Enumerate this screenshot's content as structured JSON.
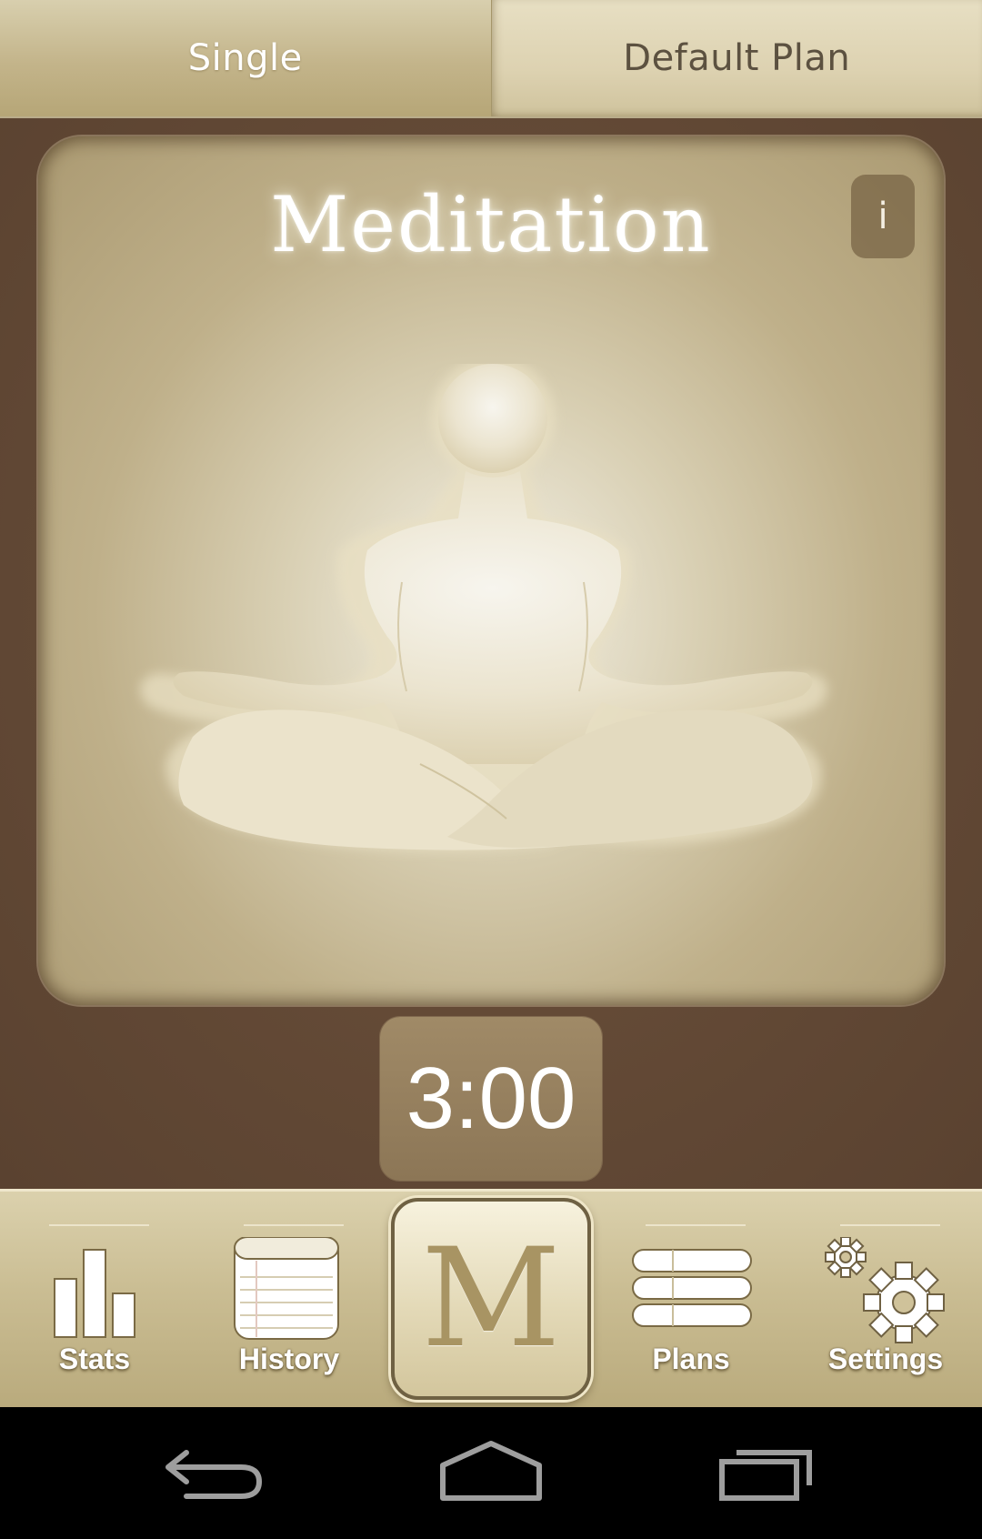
{
  "top_tabs": {
    "single": "Single",
    "default_plan": "Default Plan"
  },
  "card": {
    "title": "Meditation",
    "info_label": "i",
    "figure_icon": "meditating-figure-icon"
  },
  "timer": {
    "value": "3:00"
  },
  "bottom_nav": {
    "stats": "Stats",
    "history": "History",
    "meditate_letter": "M",
    "plans": "Plans",
    "settings": "Settings"
  },
  "system_nav": {
    "back_icon": "back-icon",
    "home_icon": "home-icon",
    "recents_icon": "recents-icon"
  },
  "colors": {
    "background_brown": "#654b37",
    "bar_tan": "#cabd93",
    "card_light": "#f3f0e6",
    "timer_bg": "#8c7656"
  }
}
